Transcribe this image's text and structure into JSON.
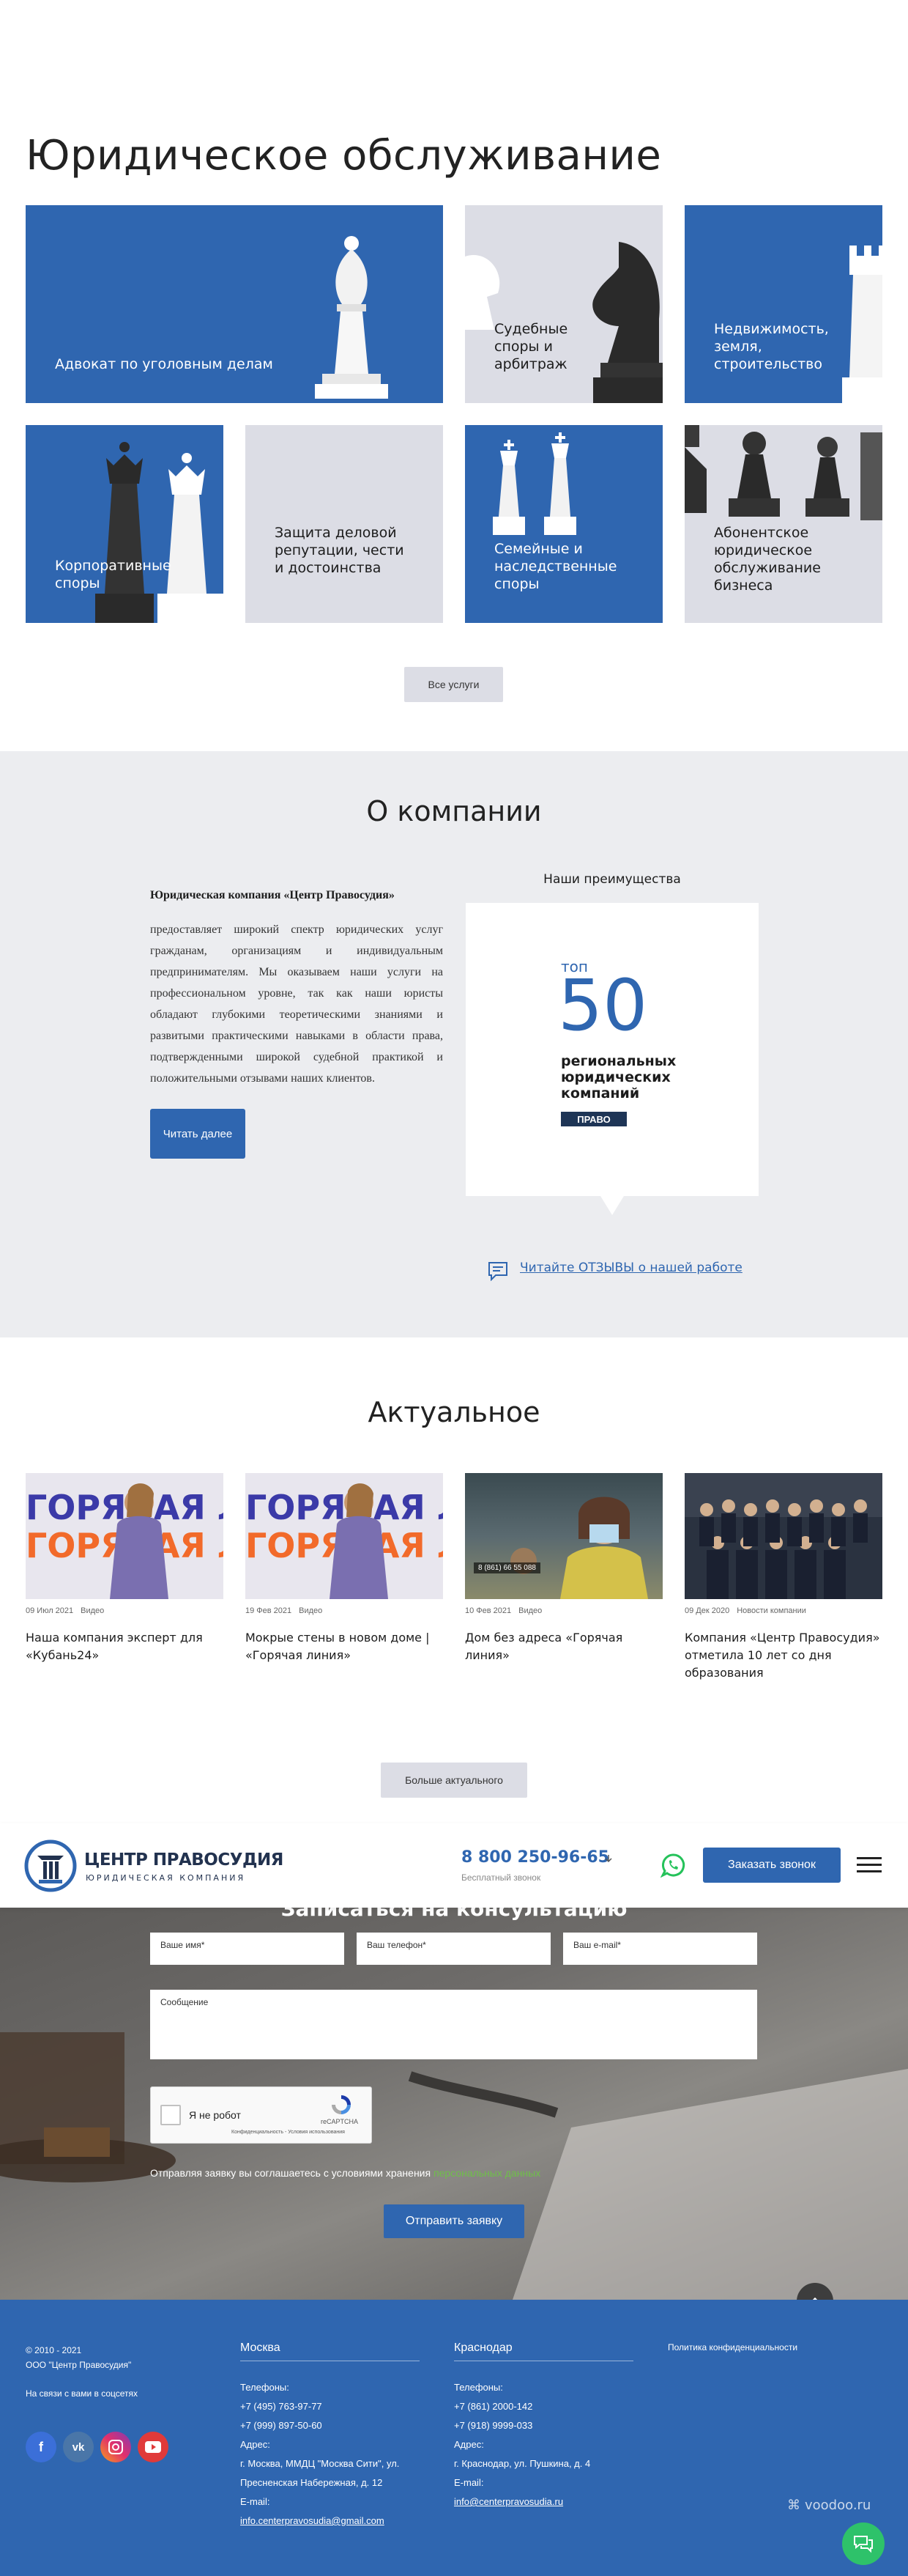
{
  "services": {
    "title": "Юридическое обслуживание",
    "tiles": [
      {
        "label": "Адвокат по уголовным делам"
      },
      {
        "label": "Судебные споры и арбитраж"
      },
      {
        "label": "Недвижимость, земля, строительство"
      },
      {
        "label": "Корпоративные споры"
      },
      {
        "label": "Защита деловой репутации, чести и достоинства"
      },
      {
        "label": "Семейные и наследственные споры"
      },
      {
        "label": "Абонентское юридическое обслуживание бизнеса"
      }
    ],
    "all_button": "Все услуги"
  },
  "about": {
    "title": "О компании",
    "company_name": "Юридическая компания «Центр Правосудия»",
    "text": "предоставляет широкий спектр юридических услуг гражданам, организациям и индивидуальным предпринимателям. Мы оказываем наши услуги на профессиональном уровне, так как наши юристы обладают глубокими теоретическими знаниями и развитыми практическими навыками в области права, подтвержденными широкой судебной практикой и положительными отзывами наших клиентов.",
    "read_button": "Читать далее",
    "advantages_title": "Наши преимущества",
    "advantage": {
      "top": "топ",
      "number": "50",
      "caption": "региональных юридических компаний",
      "brand": "ПРАВО"
    },
    "reviews_link": "Читайте ОТЗЫВЫ о нашей работе"
  },
  "news": {
    "title": "Актуальное",
    "items": [
      {
        "date": "09 Июл 2021",
        "category": "Видео",
        "title": "Наша компания эксперт для «Кубань24»"
      },
      {
        "date": "19 Фев 2021",
        "category": "Видео",
        "title": "Мокрые стены в новом доме | «Горячая линия»"
      },
      {
        "date": "10 Фев 2021",
        "category": "Видео",
        "title": "Дом без адреса «Горячая линия»"
      },
      {
        "date": "09 Дек 2020",
        "category": "Новости компании",
        "title": "Компания «Центр Правосудия» отметила 10 лет со дня образования"
      }
    ],
    "img_text_1": "ГОРЯЧАЯ ЛИНИЯ",
    "img_text_3": "8 (861) 66 55 088",
    "more_button": "Больше актуального"
  },
  "header": {
    "logo_name": "ЦЕНТР ПРАВОСУДИЯ",
    "logo_sub": "ЮРИДИЧЕСКАЯ КОМПАНИЯ",
    "phone": "8 800 250-96-65",
    "phone_sub": "Бесплатный звонок",
    "call_button": "Заказать звонок"
  },
  "form": {
    "title": "Записаться на консультацию",
    "name_placeholder": "Ваше имя*",
    "phone_placeholder": "Ваш телефон*",
    "email_placeholder": "Ваш e-mail*",
    "message_placeholder": "Сообщение",
    "captcha_label": "Я не робот",
    "captcha_brand": "reCAPTCHA",
    "captcha_links": "Конфиденциальность - Условия использования",
    "agree_text": "Отправляя заявку вы соглашаетесь с условиями хранения",
    "agree_link": "персональных данных",
    "submit": "Отправить заявку"
  },
  "footer": {
    "copyright": "© 2010 - 2021",
    "company": "ООО \"Центр Правосудия\"",
    "social_label": "На связи с вами в соцсетях",
    "moscow": {
      "city": "Москва",
      "phones_label": "Телефоны:",
      "phone1": "+7 (495) 763-97-77",
      "phone2": "+7 (999) 897-50-60",
      "address_label": "Адрес:",
      "address": "г. Москва, ММДЦ \"Москва Сити\", ул. Пресненская Набережная, д. 12",
      "email_label": "E-mail:",
      "email": "info.centerpravosudia@gmail.com"
    },
    "krasnodar": {
      "city": "Краснодар",
      "phones_label": "Телефоны:",
      "phone1": "+7 (861) 2000-142",
      "phone2": "+7 (918) 9999-033",
      "address_label": "Адрес:",
      "address": "г. Краснодар, ул. Пушкина, д. 4",
      "email_label": "E-mail:",
      "email": "info@centerpravosudia.ru"
    },
    "privacy": "Политика конфиденциальности",
    "watermark": "voodoo.ru"
  }
}
